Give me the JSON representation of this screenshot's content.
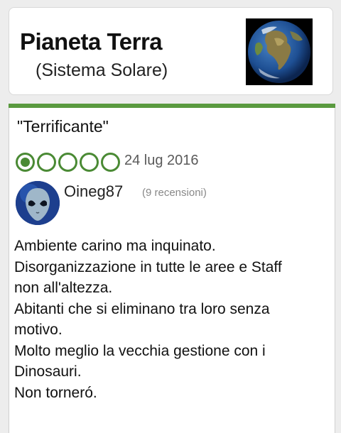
{
  "place": {
    "name": "Pianeta Terra",
    "subtitle": "(Sistema Solare)",
    "photo_icon": "earth-globe"
  },
  "review": {
    "title": "\"Terrificante\"",
    "rating": 1,
    "rating_max": 5,
    "date": "24 lug 2016",
    "accent_color": "#4a8a34",
    "author": {
      "username": "Oineg87",
      "review_count": "(9 recensioni)",
      "avatar_icon": "alien-avatar"
    },
    "body_lines": [
      "Ambiente carino ma inquinato.",
      "Disorganizzazione in tutte le aree e Staff",
      "non all'altezza.",
      "Abitanti che si eliminano tra loro senza",
      "motivo.",
      "Molto meglio la vecchia gestione con i",
      "Dinosauri.",
      "Non torneró."
    ]
  }
}
